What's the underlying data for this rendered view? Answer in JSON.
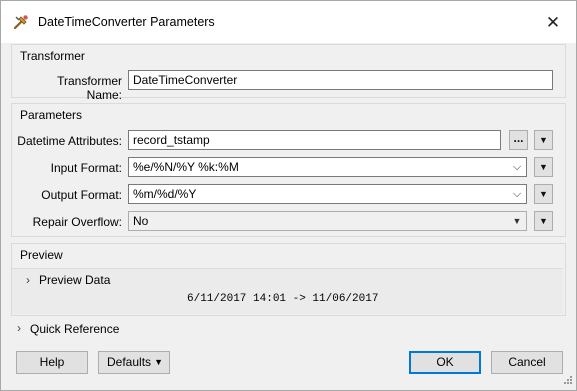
{
  "window": {
    "title": "DateTimeConverter Parameters",
    "close_label": "✕"
  },
  "transformer_section": {
    "title": "Transformer",
    "name_label": "Transformer Name:",
    "name_value": "DateTimeConverter"
  },
  "parameters_section": {
    "title": "Parameters",
    "datetime_attributes_label": "Datetime Attributes:",
    "datetime_attributes_value": "record_tstamp",
    "ellipsis_label": "...",
    "input_format_label": "Input Format:",
    "input_format_value": "%e/%N/%Y %k:%M",
    "output_format_label": "Output Format:",
    "output_format_value": "%m/%d/%Y",
    "repair_overflow_label": "Repair Overflow:",
    "repair_overflow_value": "No"
  },
  "preview_section": {
    "title": "Preview",
    "preview_data_label": "Preview Data",
    "preview_example": "6/11/2017 14:01 -> 11/06/2017"
  },
  "quick_reference": {
    "label": "Quick Reference"
  },
  "footer": {
    "help_label": "Help",
    "defaults_label": "Defaults",
    "ok_label": "OK",
    "cancel_label": "Cancel"
  },
  "icons": {
    "app": "transformer-tools-icon",
    "chevron": "chevron-down-icon",
    "expander": "chevron-right-icon",
    "menu_arrow": "triangle-down-icon"
  }
}
